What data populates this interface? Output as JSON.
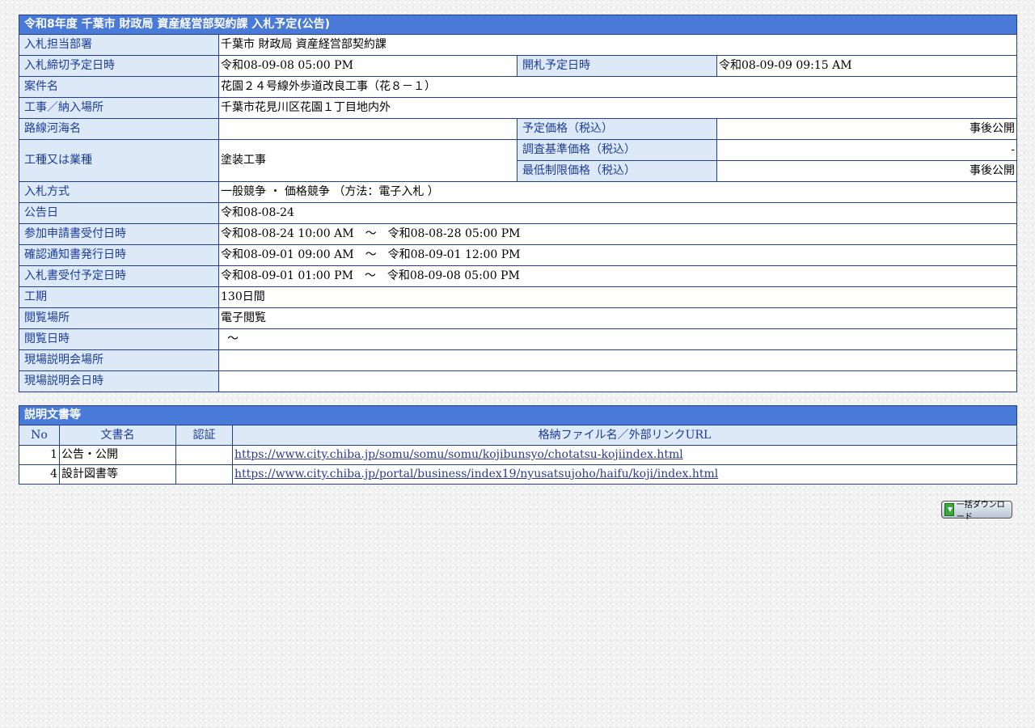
{
  "title": "令和8年度 千葉市 財政局 資産経営部契約課 入札予定(公告)",
  "rows": {
    "dept_label": "入札担当部署",
    "dept": "千葉市 財政局 資産経営部契約課",
    "deadline_label": "入札締切予定日時",
    "deadline": "令和08-09-08 05:00 PM",
    "open_label": "開札予定日時",
    "open": "令和08-09-09 09:15 AM",
    "case_label": "案件名",
    "case": "花園２４号線外歩道改良工事（花８－１）",
    "place_label": "工事／納入場所",
    "place": "千葉市花見川区花園１丁目地内外",
    "route_label": "路線河海名",
    "route": "",
    "planned_price_label": "予定価格（税込）",
    "planned_price": "事後公開",
    "type_label": "工種又は業種",
    "type": "塗装工事",
    "survey_price_label": "調査基準価格（税込）",
    "survey_price": "-",
    "min_price_label": "最低制限価格（税込）",
    "min_price": "事後公開",
    "method_label": "入札方式",
    "method": "一般競争 ・ 価格競争 （方法：電子入札 ）",
    "notice_label": "公告日",
    "notice": "令和08-08-24",
    "apply_label": "参加申請書受付日時",
    "apply": "令和08-08-24 10:00 AM　～　令和08-08-28 05:00 PM",
    "confirm_label": "確認通知書発行日時",
    "confirm": "令和08-09-01 09:00 AM　～　令和08-09-01 12:00 PM",
    "bid_label": "入札書受付予定日時",
    "bid": "令和08-09-01 01:00 PM　～　令和08-09-08 05:00 PM",
    "period_label": "工期",
    "period": "130日間",
    "view_place_label": "閲覧場所",
    "view_place": "電子閲覧",
    "view_date_label": "閲覧日時",
    "view_date": "～",
    "site_place_label": "現場説明会場所",
    "site_place": "",
    "site_date_label": "現場説明会日時",
    "site_date": ""
  },
  "docs": {
    "title": "説明文書等",
    "headers": [
      "No",
      "文書名",
      "認証",
      "格納ファイル名／外部リンクURL"
    ],
    "items": [
      {
        "no": "1",
        "name": "公告・公開",
        "auth": "",
        "url": "https://www.city.chiba.jp/somu/somu/somu/kojibunsyo/chotatsu-kojiindex.html"
      },
      {
        "no": "4",
        "name": "設計図書等",
        "auth": "",
        "url": "https://www.city.chiba.jp/portal/business/index19/nyusatsujoho/haifu/koji/index.html"
      }
    ]
  },
  "download_button": "一括ダウンロード"
}
